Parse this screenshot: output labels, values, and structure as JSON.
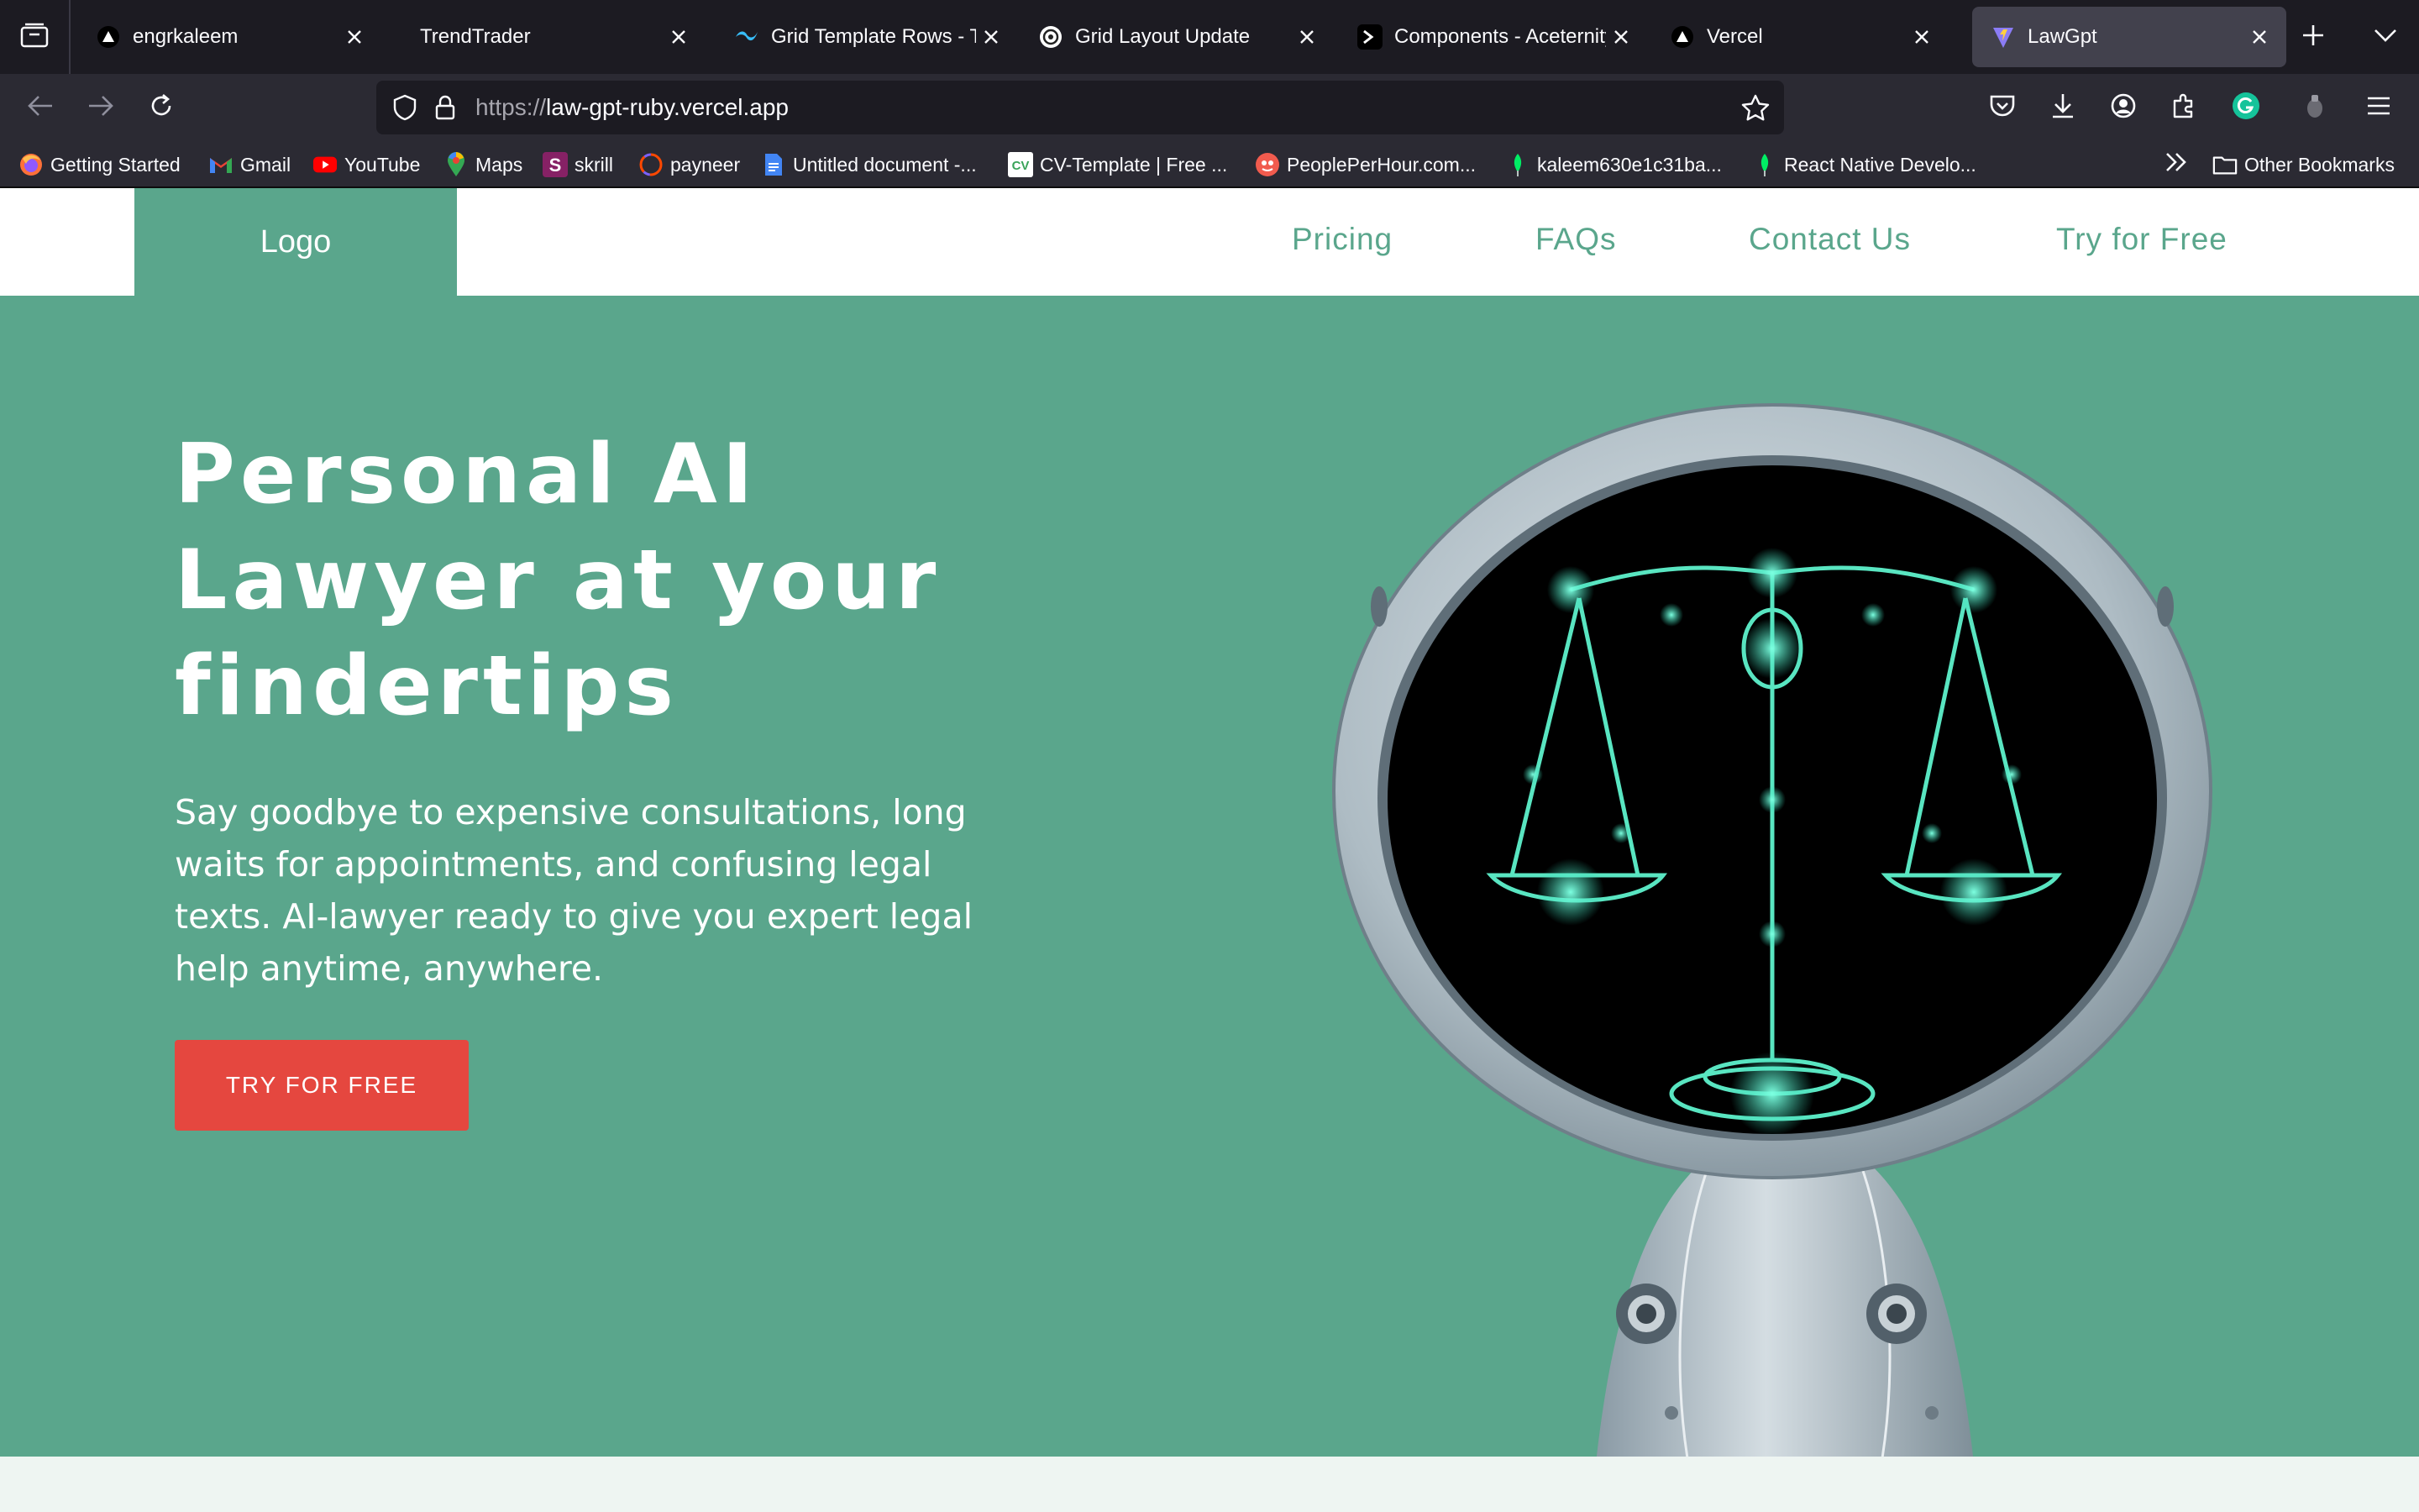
{
  "browser": {
    "tabs": [
      {
        "title": "engrkaleem",
        "icon": "vercel-triangle-icon",
        "active": false
      },
      {
        "title": "TrendTrader",
        "icon": "none",
        "active": false
      },
      {
        "title": "Grid Template Rows - Tai",
        "icon": "tailwind-icon",
        "active": false
      },
      {
        "title": "Grid Layout Update",
        "icon": "openai-icon",
        "active": false
      },
      {
        "title": "Components - Aceternity",
        "icon": "aceternity-icon",
        "active": false
      },
      {
        "title": "Vercel",
        "icon": "vercel-triangle-icon",
        "active": false
      },
      {
        "title": "LawGpt",
        "icon": "vite-icon",
        "active": true
      }
    ],
    "url": {
      "scheme": "https://",
      "host": "law-gpt-ruby.vercel.app"
    },
    "bookmarks": [
      {
        "label": "Getting Started",
        "icon": "firefox-icon"
      },
      {
        "label": "Gmail",
        "icon": "gmail-icon"
      },
      {
        "label": "YouTube",
        "icon": "youtube-icon"
      },
      {
        "label": "Maps",
        "icon": "maps-pin-icon"
      },
      {
        "label": "skrill",
        "icon": "skrill-icon"
      },
      {
        "label": "payneer",
        "icon": "payoneer-icon"
      },
      {
        "label": "Untitled document -...",
        "icon": "google-docs-icon"
      },
      {
        "label": "CV-Template | Free ...",
        "icon": "cv-icon"
      },
      {
        "label": "PeoplePerHour.com...",
        "icon": "peopleperhour-icon"
      },
      {
        "label": "kaleem630e1c31ba...",
        "icon": "mongodb-leaf-icon"
      },
      {
        "label": "React Native Develo...",
        "icon": "mongodb-leaf-icon"
      }
    ],
    "other_bookmarks": "Other Bookmarks"
  },
  "site": {
    "logo": "Logo",
    "nav": [
      "Pricing",
      "FAQs",
      "Contact Us",
      "Try for Free"
    ],
    "hero": {
      "title_lines": [
        "Personal AI",
        "Lawyer at your",
        "findertips"
      ],
      "subtitle": "Say goodbye to expensive consultations, long waits for appointments, and confusing legal texts. AI-lawyer ready to give you expert legal help anytime, anywhere.",
      "cta": "TRY FOR FREE",
      "image": "robot-with-justice-scales-illustration"
    }
  },
  "colors": {
    "brand_green": "#5aa68c",
    "cta_red": "#e5473f",
    "browser_dark": "#1c1b22",
    "browser_toolbar": "#2b2a33",
    "active_tab": "#42414d"
  }
}
